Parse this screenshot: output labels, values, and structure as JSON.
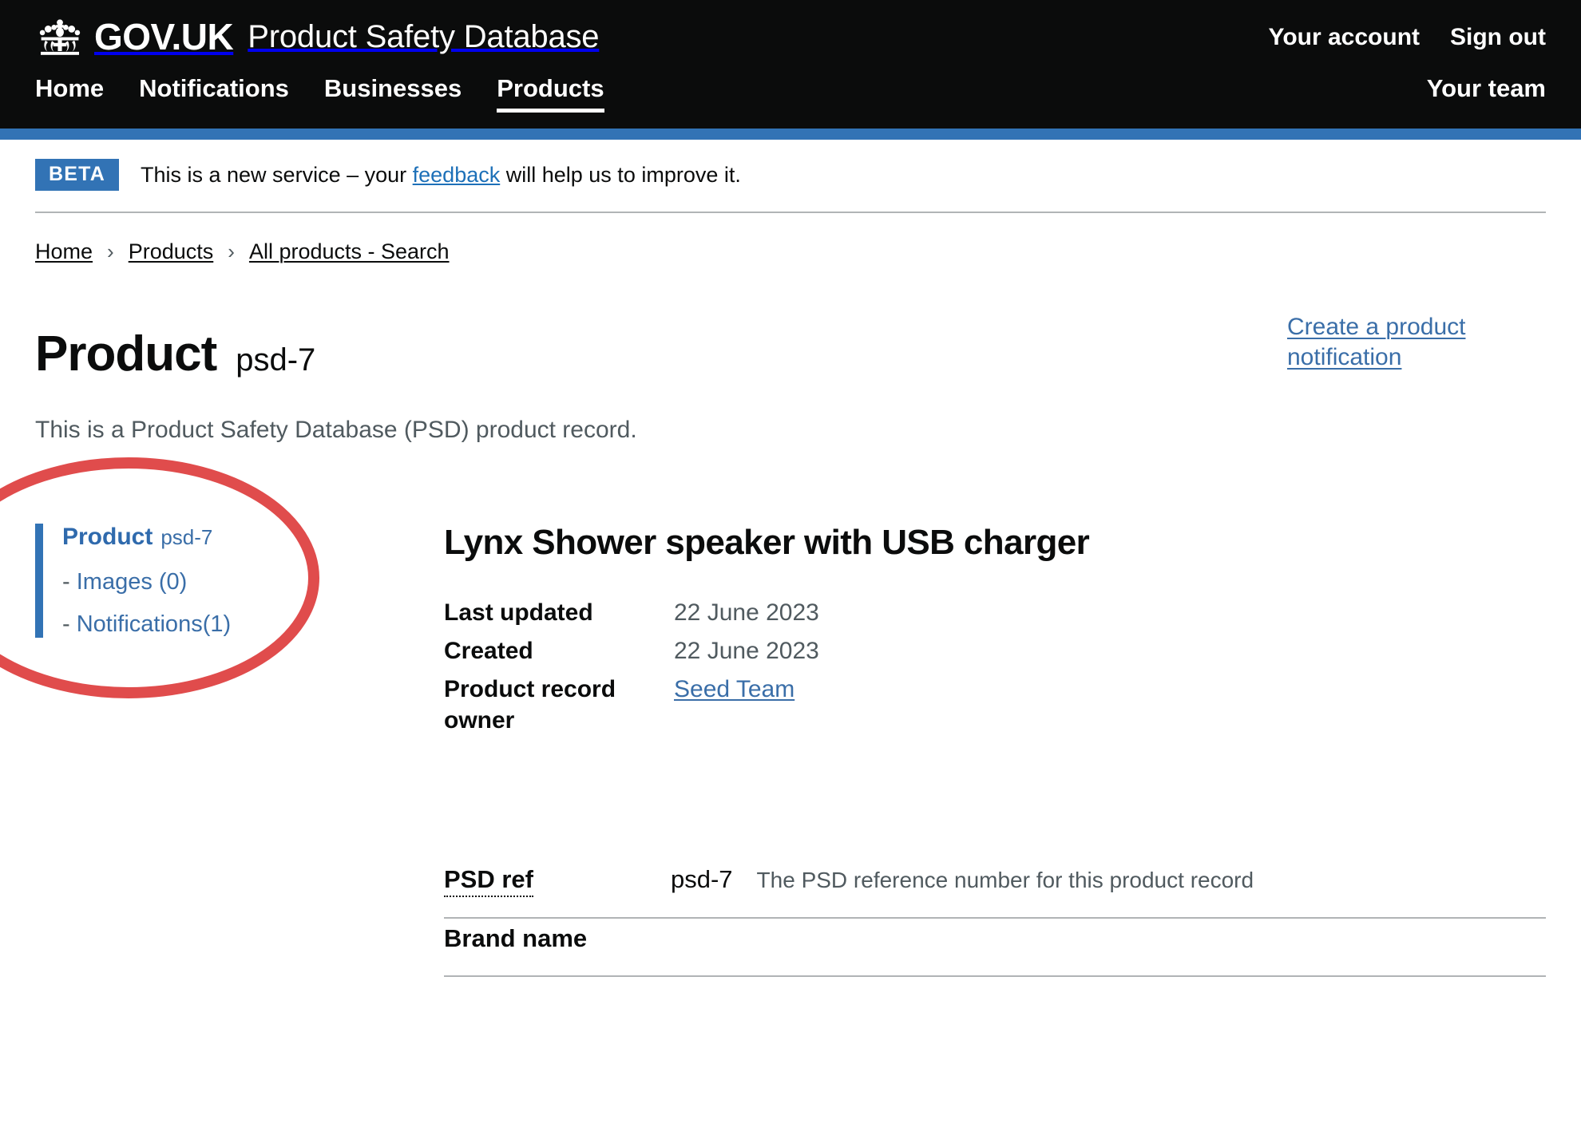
{
  "header": {
    "logotype": "GOV.UK",
    "service_name": "Product Safety Database",
    "crown_icon": "crown-icon",
    "account_links": [
      {
        "label": "Your account"
      },
      {
        "label": "Sign out"
      }
    ],
    "nav_items": [
      {
        "label": "Home",
        "current": false
      },
      {
        "label": "Notifications",
        "current": false
      },
      {
        "label": "Businesses",
        "current": false
      },
      {
        "label": "Products",
        "current": true
      }
    ],
    "nav_right": {
      "label": "Your team"
    }
  },
  "phase_banner": {
    "tag": "BETA",
    "text_before": "This is a new service – your",
    "link": "feedback",
    "text_after": "will help us to improve it."
  },
  "breadcrumbs": {
    "separator": "›",
    "items": [
      {
        "label": "Home"
      },
      {
        "label": "Products"
      },
      {
        "label": "All products - Search"
      }
    ]
  },
  "page": {
    "heading": "Product",
    "heading_ref": "psd-7",
    "lede": "This is a Product Safety Database (PSD) product record.",
    "create_notification_link": "Create a product notification"
  },
  "side_nav": {
    "title_label": "Product",
    "title_ref": "psd-7",
    "items": [
      {
        "prefix": "-",
        "label": "Images (0)"
      },
      {
        "prefix": "-",
        "label": "Notifications(1)"
      }
    ]
  },
  "product": {
    "title": "Lynx Shower speaker with USB charger",
    "meta": [
      {
        "key": "Last updated",
        "value": "22 June 2023",
        "is_link": false
      },
      {
        "key": "Created",
        "value": "22 June 2023",
        "is_link": false
      },
      {
        "key": "Product record owner",
        "value": "Seed Team",
        "is_link": true
      }
    ],
    "details": [
      {
        "key": "PSD ref",
        "value": "psd-7",
        "hint": "The PSD reference number for this product record",
        "abbr": true
      },
      {
        "key": "Brand name",
        "value": "",
        "hint": "",
        "abbr": false
      }
    ]
  },
  "annotation": {
    "shape": "ellipse",
    "color": "#e04c4c",
    "target": "side-nav"
  },
  "colors": {
    "header_black": "#0b0c0c",
    "govuk_blue": "#3273b5",
    "link_blue": "#3a6ea8",
    "text_grey": "#505a5f",
    "border_grey": "#b1b4b6",
    "annotation_red": "#e04c4c"
  }
}
